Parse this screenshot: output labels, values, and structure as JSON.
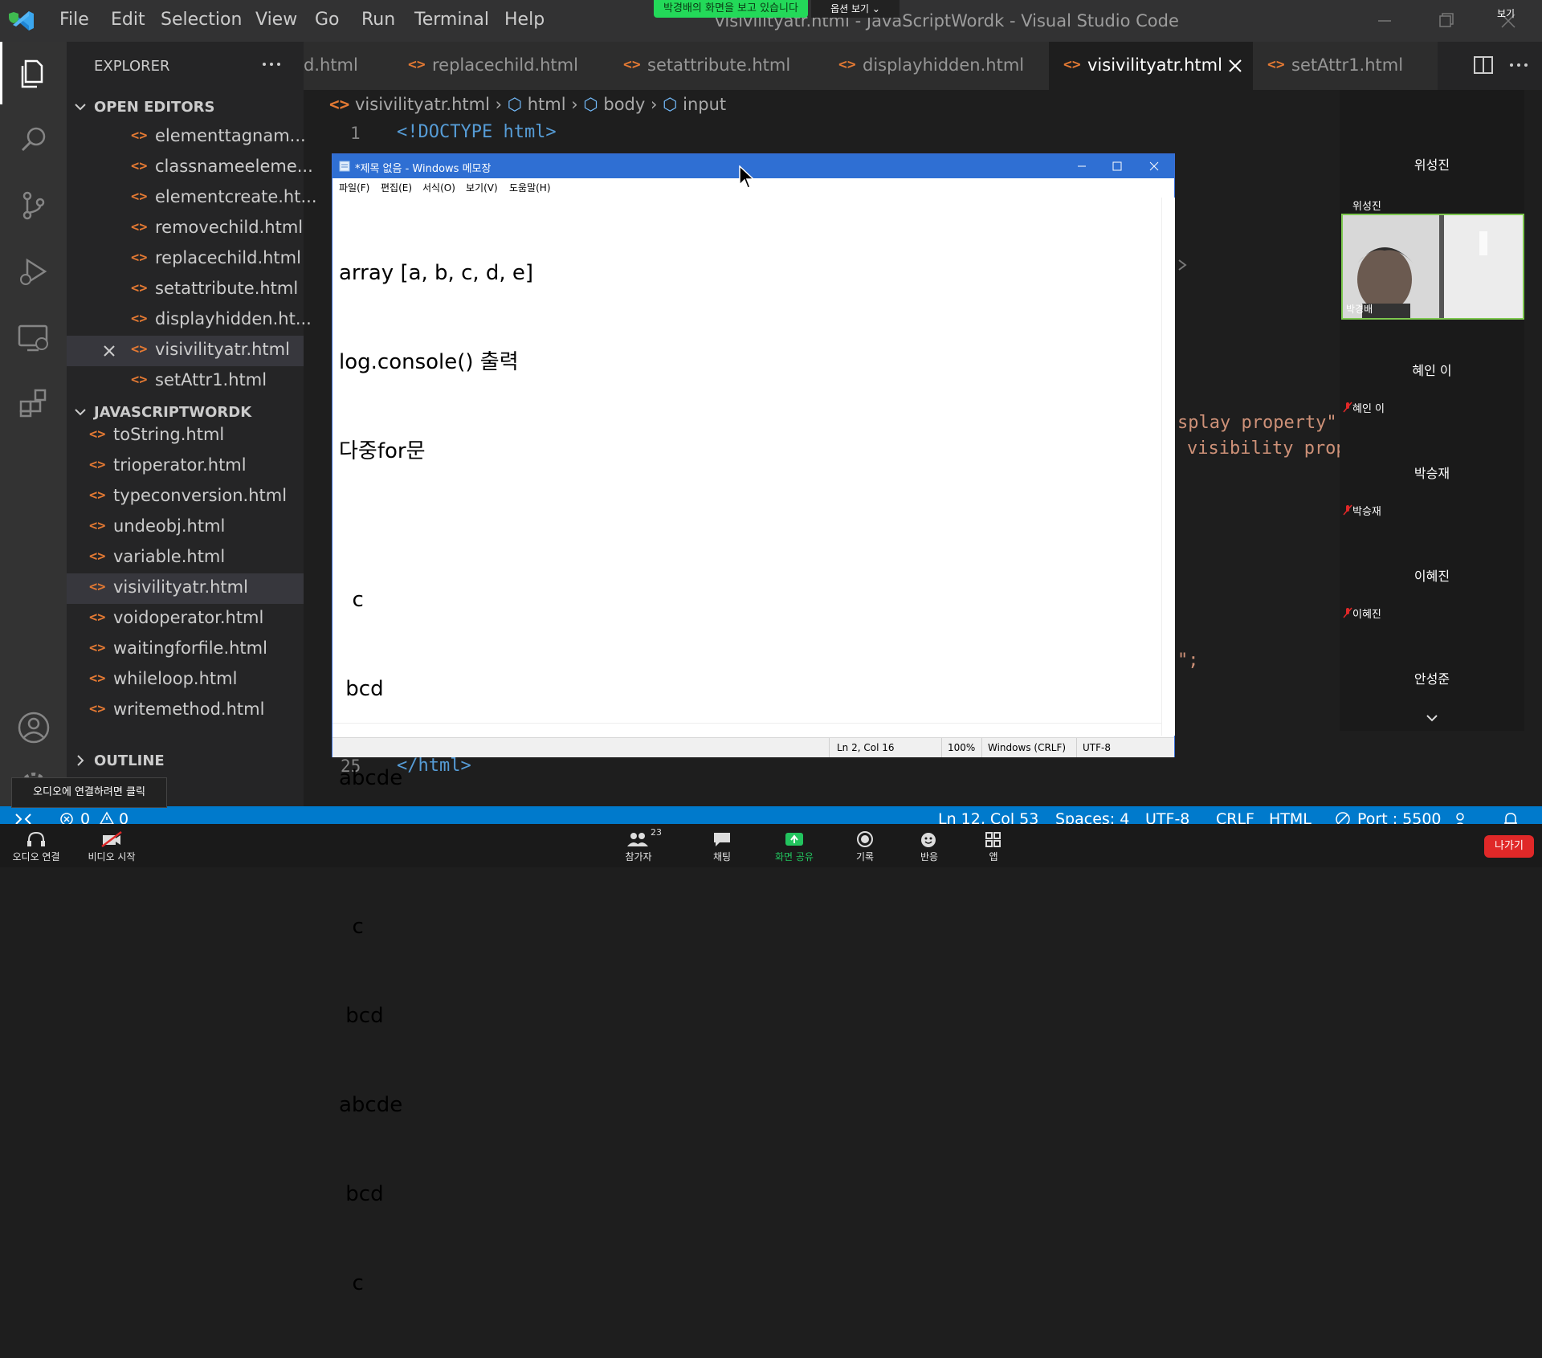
{
  "titlebar": {
    "menu": [
      "File",
      "Edit",
      "Selection",
      "View",
      "Go",
      "Run",
      "Terminal",
      "Help"
    ],
    "title": "visivilityatr.html - JavaScriptWordk - Visual Studio Code"
  },
  "zoom_share": {
    "banner": "박경배의 화면을 보고 있습니다",
    "options": "옵션 보기 ⌄",
    "view": "보기"
  },
  "sidebar": {
    "header": "EXPLORER",
    "open_editors_label": "OPEN EDITORS",
    "open_editors": [
      "elementtagnam...",
      "classnameeleme...",
      "elementcreate.ht...",
      "removechild.html",
      "replacechild.html",
      "setattribute.html",
      "displayhidden.ht...",
      "visivilityatr.html",
      "setAttr1.html"
    ],
    "folder_label": "JAVASCRIPTWORDK",
    "folder_files": [
      "toString.html",
      "trioperator.html",
      "typeconversion.html",
      "undeobj.html",
      "variable.html",
      "visivilityatr.html",
      "voidoperator.html",
      "waitingforfile.html",
      "whileloop.html",
      "writemethod.html"
    ],
    "outline_label": "OUTLINE"
  },
  "tabs": [
    {
      "label": "d.html"
    },
    {
      "label": "replacechild.html"
    },
    {
      "label": "setattribute.html"
    },
    {
      "label": "displayhidden.html"
    },
    {
      "label": "visivilityatr.html"
    },
    {
      "label": "setAttr1.html"
    }
  ],
  "breadcrumb": {
    "file": "visivilityatr.html",
    "p1": "html",
    "p2": "body",
    "p3": "input"
  },
  "editor": {
    "line1_no": "1",
    "line1_code": "<!DOCTYPE html>",
    "line25_no": "25",
    "line25_code": "</html>",
    "frag1": "splay property\"",
    "frag2": "visibility prop",
    "frag3": "\";"
  },
  "notepad": {
    "title": "*제목 없음 - Windows 메모장",
    "menu": [
      "파일(F)",
      "편집(E)",
      "서식(O)",
      "보기(V)",
      "도움말(H)"
    ],
    "lines": [
      "array [a, b, c, d, e]",
      "log.console() 출력",
      "다중for문",
      "",
      "  c",
      " bcd",
      "abcde",
      "",
      "  c",
      " bcd",
      "abcde",
      " bcd",
      "  c"
    ],
    "status": {
      "position": "Ln 2, Col 16",
      "zoom": "100%",
      "eol": "Windows (CRLF)",
      "encoding": "UTF-8"
    }
  },
  "zoom_participants": [
    {
      "name": "위성진",
      "label": "위성진"
    },
    {
      "name": "혜인 이",
      "label": "혜인 이"
    },
    {
      "name": "박승재",
      "label": "박승재"
    },
    {
      "name": "이혜진",
      "label": "이혜진"
    },
    {
      "name": "안성준",
      "label": "안성준"
    }
  ],
  "video_label": "박경배",
  "statusbar": {
    "errors": "0",
    "warnings": "0",
    "position": "Ln 12, Col 53",
    "spaces": "Spaces: 4",
    "encoding": "UTF-8",
    "eol": "CRLF",
    "lang": "HTML",
    "port": "Port : 5500"
  },
  "zoombar": {
    "audio": "오디오 연결",
    "video": "비디오 시작",
    "participants": "참가자",
    "participants_count": "23",
    "chat": "채팅",
    "share": "화면 공유",
    "record": "기록",
    "react": "반응",
    "apps": "앱",
    "leave": "나가기",
    "tooltip": "오디오에 연결하려면 클릭"
  }
}
